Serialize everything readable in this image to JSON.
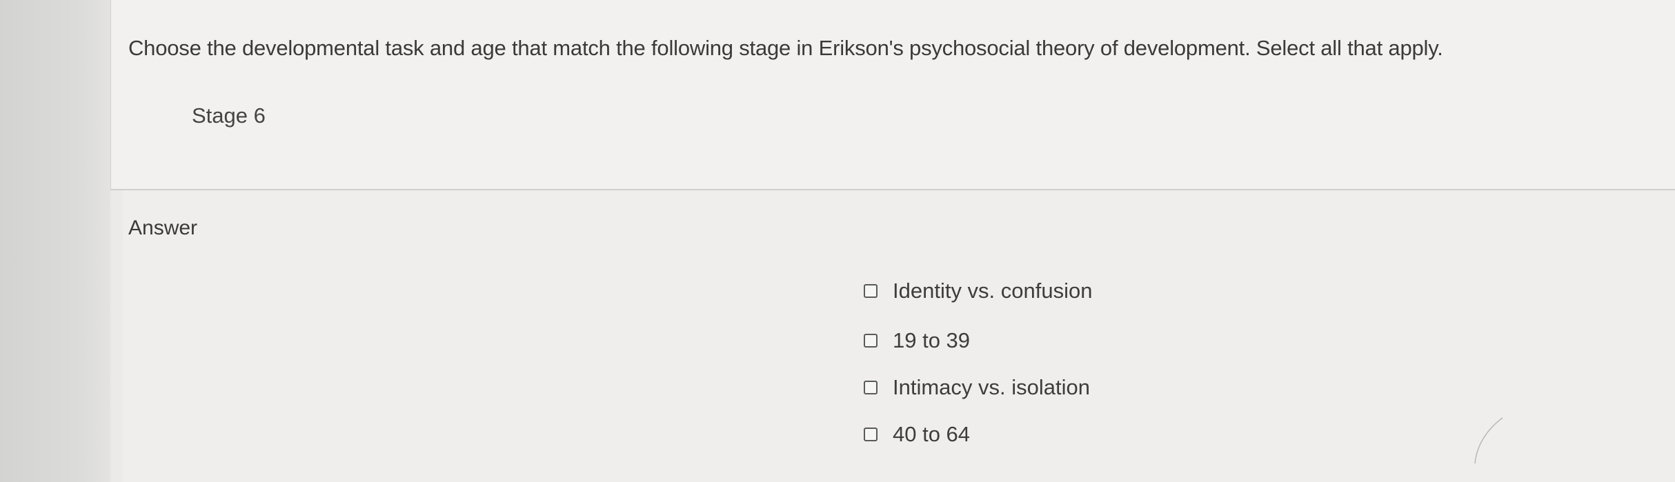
{
  "question": {
    "text": "Choose the developmental task and age that match the following stage in Erikson's psychosocial theory of development. Select all that apply.",
    "stage": "Stage 6"
  },
  "answer": {
    "heading": "Answer",
    "options": [
      {
        "label": "Identity vs. confusion",
        "checked": false
      },
      {
        "label": "19 to 39",
        "checked": false
      },
      {
        "label": "Intimacy vs. isolation",
        "checked": false
      },
      {
        "label": "40 to 64",
        "checked": false
      }
    ]
  }
}
